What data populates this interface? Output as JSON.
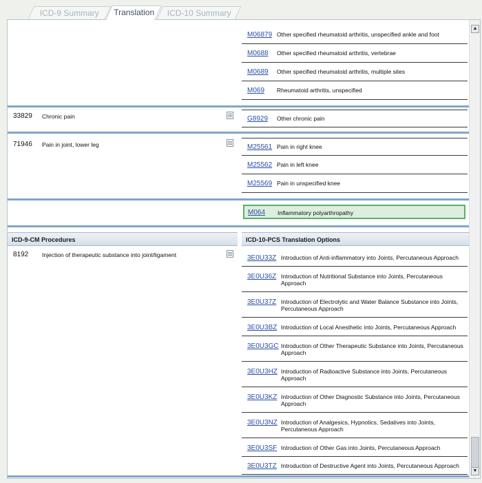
{
  "tabs": [
    {
      "label": "ICD-9 Summary",
      "active": false
    },
    {
      "label": "Translation",
      "active": true
    },
    {
      "label": "ICD-10 Summary",
      "active": false
    }
  ],
  "top_group": [
    {
      "code": "M06879",
      "desc": "Other specified rheumatoid arthritis, unspecified ankle and foot"
    },
    {
      "code": "M0688",
      "desc": "Other specified rheumatoid arthritis, vertebrae"
    },
    {
      "code": "M0689",
      "desc": "Other specified rheumatoid arthritis, multiple sites"
    },
    {
      "code": "M069",
      "desc": "Rheumatoid arthritis, unspecified"
    }
  ],
  "diagnoses": [
    {
      "code": "33829",
      "desc": "Chronic pain",
      "translations": [
        {
          "code": "G8929",
          "desc": "Other chronic pain"
        }
      ]
    },
    {
      "code": "71946",
      "desc": "Pain in joint, lower leg",
      "translations": [
        {
          "code": "M25561",
          "desc": "Pain in right knee"
        },
        {
          "code": "M25562",
          "desc": "Pain in left knee"
        },
        {
          "code": "M25569",
          "desc": "Pain in unspecified knee"
        }
      ]
    }
  ],
  "selected": {
    "code": "M064",
    "desc": "Inflammatory polyarthropathy"
  },
  "procedures": {
    "left_header": "ICD-9-CM Procedures",
    "right_header": "ICD-10-PCS Translation Options",
    "item": {
      "code": "8192",
      "desc": "Injection of therapeutic substance into joint/ligament"
    },
    "options": [
      {
        "code": "3E0U33Z",
        "desc": "Introduction of Anti-inflammatory into Joints, Percutaneous Approach"
      },
      {
        "code": "3E0U36Z",
        "desc": "Introduction of Nutritional Substance into Joints, Percutaneous Approach"
      },
      {
        "code": "3E0U37Z",
        "desc": "Introduction of Electrolytic and Water Balance Substance into Joints, Percutaneous Approach"
      },
      {
        "code": "3E0U3BZ",
        "desc": "Introduction of Local Anesthetic into Joints, Percutaneous Approach"
      },
      {
        "code": "3E0U3GC",
        "desc": "Introduction of Other Therapeutic Substance into Joints, Percutaneous Approach"
      },
      {
        "code": "3E0U3HZ",
        "desc": "Introduction of Radioactive Substance into Joints, Percutaneous Approach"
      },
      {
        "code": "3E0U3KZ",
        "desc": "Introduction of Other Diagnostic Substance into Joints, Percutaneous Approach"
      },
      {
        "code": "3E0U3NZ",
        "desc": "Introduction of Analgesics, Hypnotics, Sedatives into Joints, Percutaneous Approach"
      },
      {
        "code": "3E0U3SF",
        "desc": "Introduction of Other Gas into Joints, Percutaneous Approach"
      },
      {
        "code": "3E0U3TZ",
        "desc": "Introduction of Destructive Agent into Joints, Percutaneous Approach"
      }
    ]
  },
  "colors": {
    "link": "#2a4fa8",
    "separator": "#7fa6cd",
    "selected_bg": "#dceedd",
    "selected_border": "#58b068"
  }
}
